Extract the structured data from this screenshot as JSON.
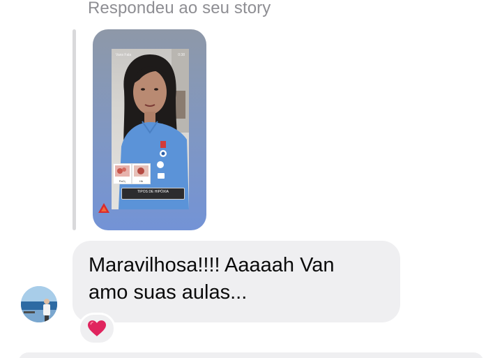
{
  "thread": {
    "reply_context": "Respondeu ao seu story",
    "story": {
      "handle": "Vans Fala",
      "time": "0:38",
      "thumb_left_label": "PaO₂",
      "thumb_right_label": "Hb",
      "caption": "TIPOS DE HIPÓXIA"
    },
    "message": {
      "line1": "Maravilhosa!!!! Aaaaah Van",
      "line2": "amo suas aulas..."
    },
    "reaction": {
      "emoji": "❤️",
      "icon": "red-heart-icon",
      "color": "#e0245e"
    }
  },
  "colors": {
    "bubble": "#efeff1",
    "secondary_text": "#8e8e93",
    "story_card": "#7f97c4"
  }
}
